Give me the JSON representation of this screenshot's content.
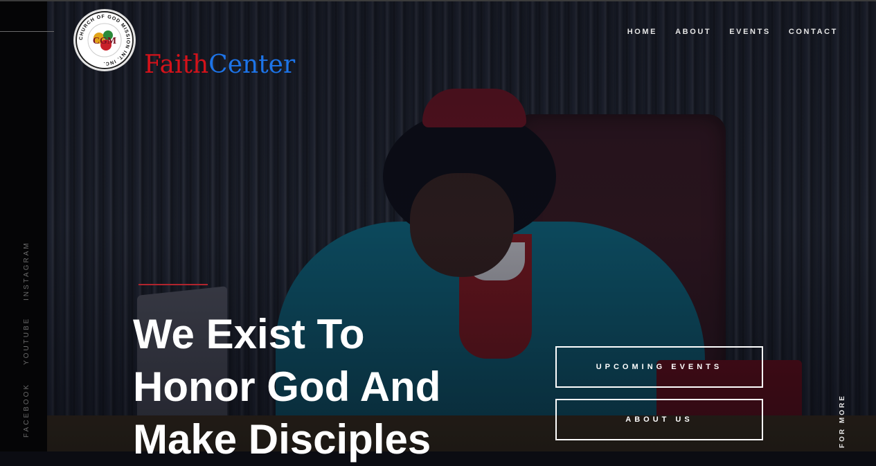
{
  "brand": {
    "logo_ring_text": "CHURCH OF GOD MISSION INT. INC.",
    "logo_monogram": "CGM",
    "name_part1": "Faith",
    "name_part2": "Center",
    "colors": {
      "faith": "#d4121a",
      "center": "#1d74e8"
    }
  },
  "nav": {
    "items": [
      {
        "label": "HOME"
      },
      {
        "label": "ABOUT"
      },
      {
        "label": "EVENTS"
      },
      {
        "label": "CONTACT"
      }
    ]
  },
  "social": {
    "items": [
      {
        "label": "FACEBOOK"
      },
      {
        "label": "YOUTUBE"
      },
      {
        "label": "INSTAGRAM"
      }
    ]
  },
  "hero": {
    "headline_lines": [
      "We Exist To",
      "Honor God And",
      "Make Disciples"
    ],
    "accent_color": "#b0242d"
  },
  "buttons": {
    "upcoming_events": "UPCOMING EVENTS",
    "about_us": "ABOUT US"
  },
  "scroll_hint": "FOR MORE"
}
